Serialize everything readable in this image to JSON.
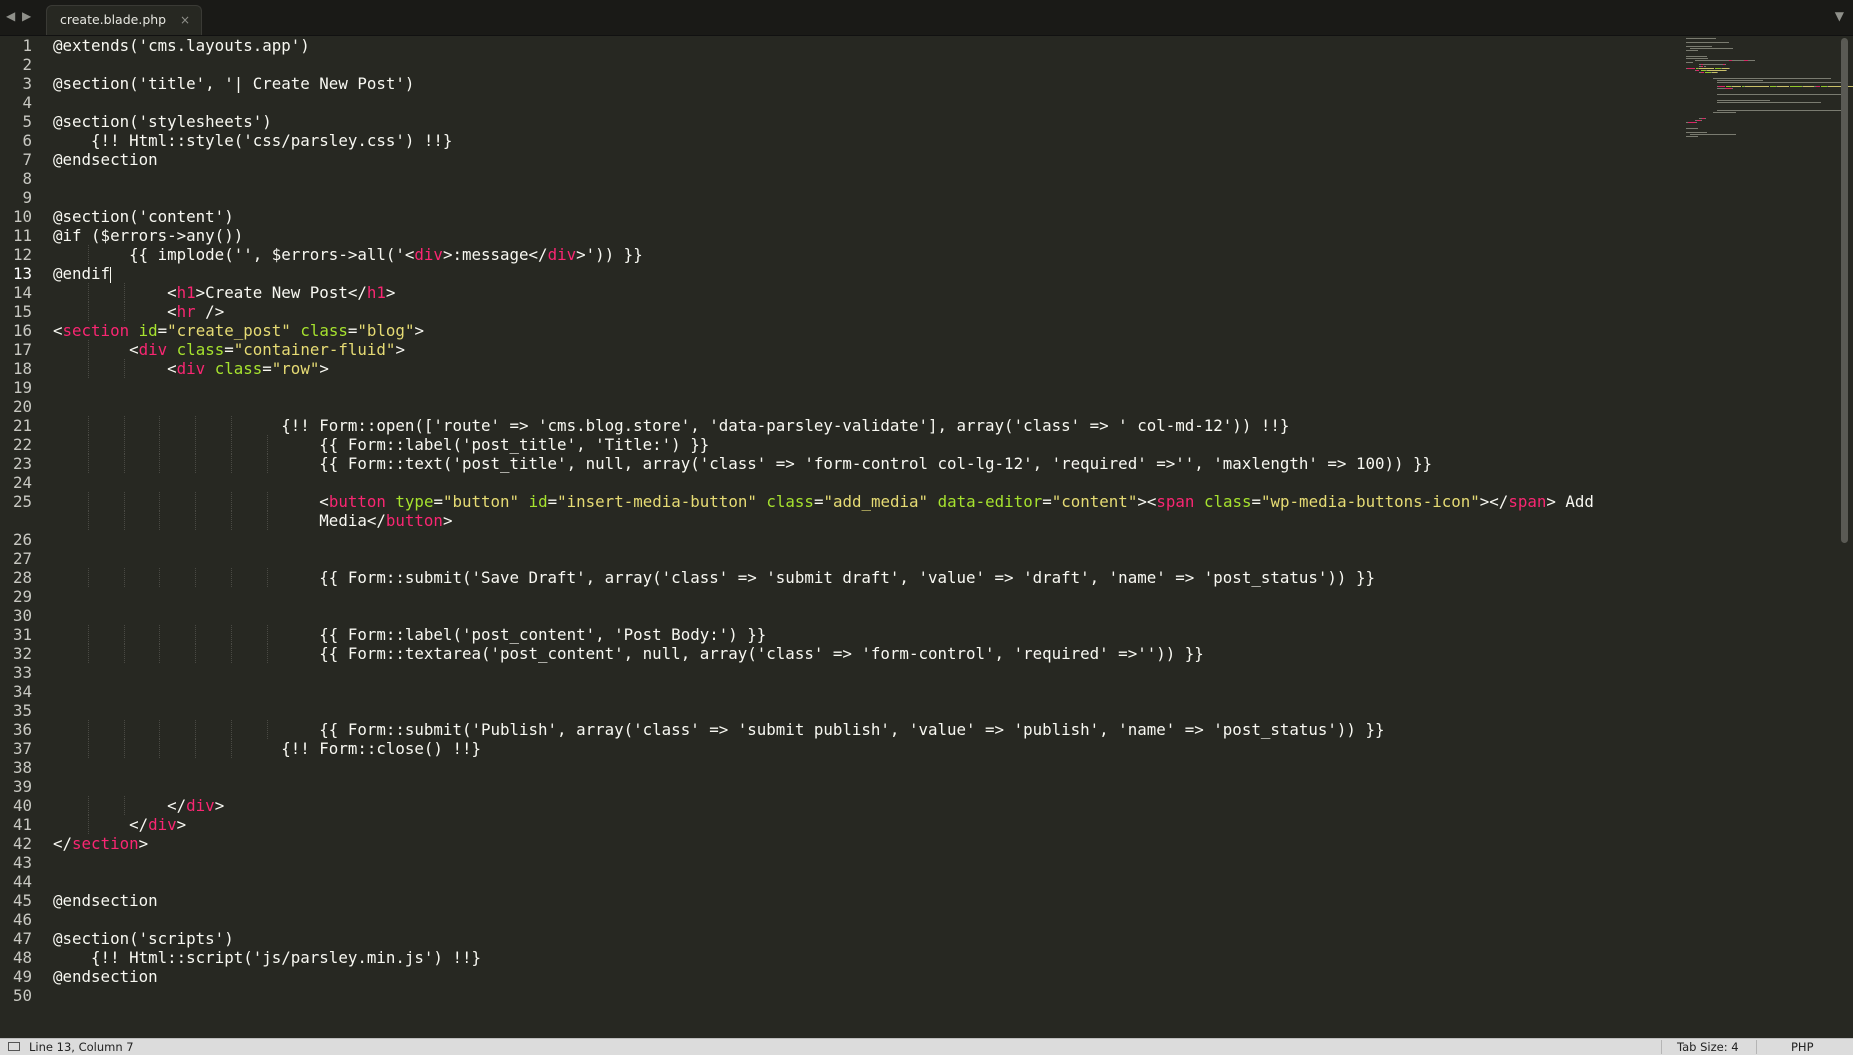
{
  "tabbar": {
    "nav_left": "◀",
    "nav_right": "▶",
    "tab_title": "create.blade.php",
    "tab_close": "×",
    "menu_arrow": "▼"
  },
  "editor": {
    "current_line": 13,
    "line_numbers": [
      "1",
      "2",
      "3",
      "4",
      "5",
      "6",
      "7",
      "8",
      "9",
      "10",
      "11",
      "12",
      "13",
      "14",
      "15",
      "16",
      "17",
      "18",
      "19",
      "20",
      "21",
      "22",
      "23",
      "24",
      "25",
      "",
      "26",
      "27",
      "28",
      "29",
      "30",
      "31",
      "32",
      "33",
      "34",
      "35",
      "36",
      "37",
      "38",
      "39",
      "40",
      "41",
      "42",
      "43",
      "44",
      "45",
      "46",
      "47",
      "48",
      "49",
      "50"
    ],
    "lines": [
      [
        [
          "t",
          "@extends('cms.layouts.app')"
        ]
      ],
      [],
      [
        [
          "t",
          "@section('title', '| Create New Post')"
        ]
      ],
      [],
      [
        [
          "t",
          "@section('stylesheets')"
        ]
      ],
      [
        [
          "t",
          "    {!! Html::style('css/parsley.css') !!}"
        ]
      ],
      [
        [
          "t",
          "@endsection"
        ]
      ],
      [],
      [],
      [
        [
          "t",
          "@section('content')"
        ]
      ],
      [
        [
          "t",
          "@if ($errors->any())"
        ]
      ],
      [
        [
          "t",
          "        {{ implode('', $errors->all('<"
        ],
        [
          "k",
          "div"
        ],
        [
          "t",
          ">:message</"
        ],
        [
          "k",
          "div"
        ],
        [
          "t",
          ">')) }}"
        ]
      ],
      [
        [
          "t",
          "@endif"
        ]
      ],
      [
        [
          "t",
          "            <"
        ],
        [
          "k",
          "h1"
        ],
        [
          "t",
          ">Create New Post</"
        ],
        [
          "k",
          "h1"
        ],
        [
          "t",
          ">"
        ]
      ],
      [
        [
          "t",
          "            <"
        ],
        [
          "k",
          "hr"
        ],
        [
          "t",
          " />"
        ]
      ],
      [
        [
          "t",
          "<"
        ],
        [
          "k",
          "section"
        ],
        [
          "t",
          " "
        ],
        [
          "a",
          "id"
        ],
        [
          "t",
          "="
        ],
        [
          "s",
          "\"create_post\""
        ],
        [
          "t",
          " "
        ],
        [
          "a",
          "class"
        ],
        [
          "t",
          "="
        ],
        [
          "s",
          "\"blog\""
        ],
        [
          "t",
          ">"
        ]
      ],
      [
        [
          "t",
          "        <"
        ],
        [
          "k",
          "div"
        ],
        [
          "t",
          " "
        ],
        [
          "a",
          "class"
        ],
        [
          "t",
          "="
        ],
        [
          "s",
          "\"container-fluid\""
        ],
        [
          "t",
          ">"
        ]
      ],
      [
        [
          "t",
          "            <"
        ],
        [
          "k",
          "div"
        ],
        [
          "t",
          " "
        ],
        [
          "a",
          "class"
        ],
        [
          "t",
          "="
        ],
        [
          "s",
          "\"row\""
        ],
        [
          "t",
          ">"
        ]
      ],
      [],
      [],
      [
        [
          "t",
          "                        {!! Form::open(['route' => 'cms.blog.store', 'data-parsley-validate'], array('class' => ' col-md-12')) !!}"
        ]
      ],
      [
        [
          "t",
          "                            {{ Form::label('post_title', 'Title:') }}"
        ]
      ],
      [
        [
          "t",
          "                            {{ Form::text('post_title', null, array('class' => 'form-control col-lg-12', 'required' =>'', 'maxlength' => 100)) }}"
        ]
      ],
      [],
      [
        [
          "t",
          "                            <"
        ],
        [
          "k",
          "button"
        ],
        [
          "t",
          " "
        ],
        [
          "a",
          "type"
        ],
        [
          "t",
          "="
        ],
        [
          "s",
          "\"button\""
        ],
        [
          "t",
          " "
        ],
        [
          "a",
          "id"
        ],
        [
          "t",
          "="
        ],
        [
          "s",
          "\"insert-media-button\""
        ],
        [
          "t",
          " "
        ],
        [
          "a",
          "class"
        ],
        [
          "t",
          "="
        ],
        [
          "s",
          "\"add_media\""
        ],
        [
          "t",
          " "
        ],
        [
          "a",
          "data-editor"
        ],
        [
          "t",
          "="
        ],
        [
          "s",
          "\"content\""
        ],
        [
          "t",
          "><"
        ],
        [
          "k",
          "span"
        ],
        [
          "t",
          " "
        ],
        [
          "a",
          "class"
        ],
        [
          "t",
          "="
        ],
        [
          "s",
          "\"wp-media-buttons-icon\""
        ],
        [
          "t",
          "></"
        ],
        [
          "k",
          "span"
        ],
        [
          "t",
          "> Add"
        ]
      ],
      [
        [
          "t",
          "                            Media</"
        ],
        [
          "k",
          "button"
        ],
        [
          "t",
          ">"
        ]
      ],
      [],
      [],
      [
        [
          "t",
          "                            {{ Form::submit('Save Draft', array('class' => 'submit draft', 'value' => 'draft', 'name' => 'post_status')) }}"
        ]
      ],
      [],
      [],
      [
        [
          "t",
          "                            {{ Form::label('post_content', 'Post Body:') }}"
        ]
      ],
      [
        [
          "t",
          "                            {{ Form::textarea('post_content', null, array('class' => 'form-control', 'required' =>'')) }}"
        ]
      ],
      [],
      [],
      [],
      [
        [
          "t",
          "                            {{ Form::submit('Publish', array('class' => 'submit publish', 'value' => 'publish', 'name' => 'post_status')) }}"
        ]
      ],
      [
        [
          "t",
          "                        {!! Form::close() !!}"
        ]
      ],
      [],
      [],
      [
        [
          "t",
          "            </"
        ],
        [
          "k",
          "div"
        ],
        [
          "t",
          ">"
        ]
      ],
      [
        [
          "t",
          "        </"
        ],
        [
          "k",
          "div"
        ],
        [
          "t",
          ">"
        ]
      ],
      [
        [
          "t",
          "</"
        ],
        [
          "k",
          "section"
        ],
        [
          "t",
          ">"
        ]
      ],
      [],
      [],
      [
        [
          "t",
          "@endsection"
        ]
      ],
      [],
      [
        [
          "t",
          "@section('scripts')"
        ]
      ],
      [
        [
          "t",
          "    {!! Html::script('js/parsley.min.js') !!}"
        ]
      ],
      [
        [
          "t",
          "@endsection"
        ]
      ],
      []
    ]
  },
  "statusbar": {
    "position": "Line 13, Column 7",
    "tab_size": "Tab Size: 4",
    "syntax": "PHP"
  },
  "colors": {
    "background": "#272822",
    "keyword": "#f92672",
    "attribute": "#a6e22e",
    "string": "#e6db74",
    "text": "#f8f8f2"
  }
}
